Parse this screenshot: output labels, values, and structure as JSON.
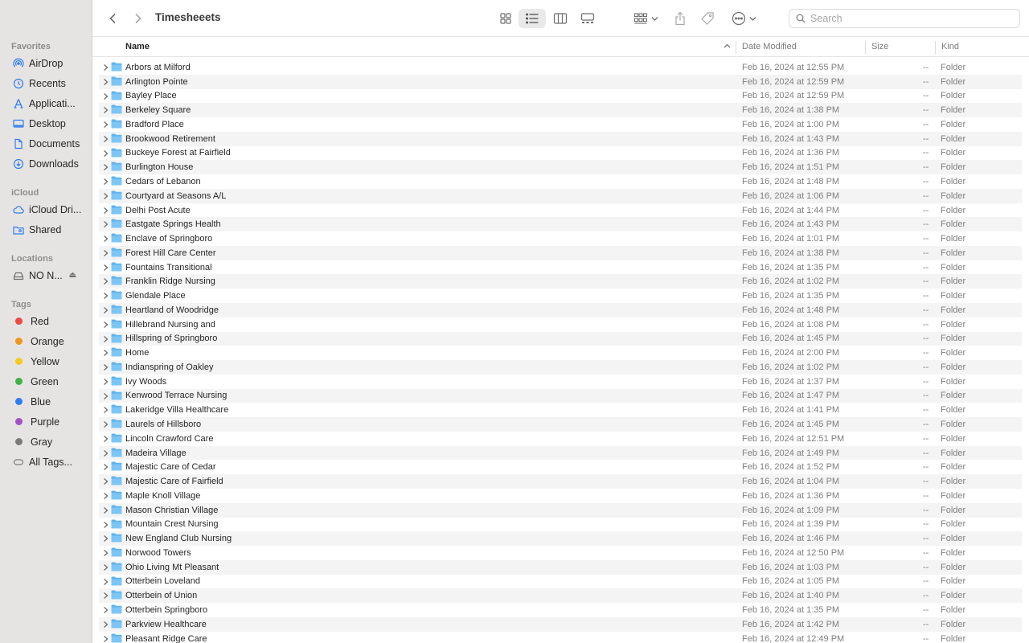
{
  "window": {
    "title": "Timesheeets"
  },
  "search": {
    "placeholder": "Search"
  },
  "sidebar": {
    "favorites_label": "Favorites",
    "favorites": [
      {
        "label": "AirDrop",
        "icon": "airdrop-icon"
      },
      {
        "label": "Recents",
        "icon": "clock-icon"
      },
      {
        "label": "Applicati...",
        "icon": "applications-icon"
      },
      {
        "label": "Desktop",
        "icon": "desktop-icon"
      },
      {
        "label": "Documents",
        "icon": "document-icon"
      },
      {
        "label": "Downloads",
        "icon": "download-icon"
      }
    ],
    "icloud_label": "iCloud",
    "icloud": [
      {
        "label": "iCloud Dri...",
        "icon": "cloud-icon"
      },
      {
        "label": "Shared",
        "icon": "shared-folder-icon"
      }
    ],
    "locations_label": "Locations",
    "locations": [
      {
        "label": "NO N...",
        "icon": "drive-icon"
      }
    ],
    "tags_label": "Tags",
    "tags": [
      {
        "label": "Red",
        "color": "#ec4a3f"
      },
      {
        "label": "Orange",
        "color": "#f0961f"
      },
      {
        "label": "Yellow",
        "color": "#f5c924"
      },
      {
        "label": "Green",
        "color": "#3fb344"
      },
      {
        "label": "Blue",
        "color": "#2f7cf2"
      },
      {
        "label": "Purple",
        "color": "#a450c6"
      },
      {
        "label": "Gray",
        "color": "#7b7b7b"
      }
    ],
    "all_tags": "All Tags..."
  },
  "columns": {
    "name": "Name",
    "date": "Date Modified",
    "size": "Size",
    "kind": "Kind"
  },
  "rows": [
    {
      "name": "Arbors at Milford",
      "date": "Feb 16, 2024 at 12:55 PM",
      "size": "--",
      "kind": "Folder"
    },
    {
      "name": "Arlington Pointe",
      "date": "Feb 16, 2024 at 12:59 PM",
      "size": "--",
      "kind": "Folder"
    },
    {
      "name": "Bayley Place",
      "date": "Feb 16, 2024 at 12:59 PM",
      "size": "--",
      "kind": "Folder"
    },
    {
      "name": "Berkeley Square",
      "date": "Feb 16, 2024 at 1:38 PM",
      "size": "--",
      "kind": "Folder"
    },
    {
      "name": "Bradford Place",
      "date": "Feb 16, 2024 at 1:00 PM",
      "size": "--",
      "kind": "Folder"
    },
    {
      "name": "Brookwood Retirement",
      "date": "Feb 16, 2024 at 1:43 PM",
      "size": "--",
      "kind": "Folder"
    },
    {
      "name": "Buckeye Forest at Fairfield",
      "date": "Feb 16, 2024 at 1:36 PM",
      "size": "--",
      "kind": "Folder"
    },
    {
      "name": "Burlington House",
      "date": "Feb 16, 2024 at 1:51 PM",
      "size": "--",
      "kind": "Folder"
    },
    {
      "name": "Cedars of Lebanon",
      "date": "Feb 16, 2024 at 1:48 PM",
      "size": "--",
      "kind": "Folder"
    },
    {
      "name": "Courtyard at Seasons A/L",
      "date": "Feb 16, 2024 at 1:06 PM",
      "size": "--",
      "kind": "Folder"
    },
    {
      "name": "Delhi Post Acute",
      "date": "Feb 16, 2024 at 1:44 PM",
      "size": "--",
      "kind": "Folder"
    },
    {
      "name": "Eastgate Springs Health",
      "date": "Feb 16, 2024 at 1:43 PM",
      "size": "--",
      "kind": "Folder"
    },
    {
      "name": "Enclave of Springboro",
      "date": "Feb 16, 2024 at 1:01 PM",
      "size": "--",
      "kind": "Folder"
    },
    {
      "name": "Forest Hill Care Center",
      "date": "Feb 16, 2024 at 1:38 PM",
      "size": "--",
      "kind": "Folder"
    },
    {
      "name": "Fountains Transitional",
      "date": "Feb 16, 2024 at 1:35 PM",
      "size": "--",
      "kind": "Folder"
    },
    {
      "name": "Franklin Ridge Nursing",
      "date": "Feb 16, 2024 at 1:02 PM",
      "size": "--",
      "kind": "Folder"
    },
    {
      "name": "Glendale Place",
      "date": "Feb 16, 2024 at 1:35 PM",
      "size": "--",
      "kind": "Folder"
    },
    {
      "name": "Heartland of Woodridge",
      "date": "Feb 16, 2024 at 1:48 PM",
      "size": "--",
      "kind": "Folder"
    },
    {
      "name": "Hillebrand Nursing and",
      "date": "Feb 16, 2024 at 1:08 PM",
      "size": "--",
      "kind": "Folder"
    },
    {
      "name": "Hillspring of Springboro",
      "date": "Feb 16, 2024 at 1:45 PM",
      "size": "--",
      "kind": "Folder"
    },
    {
      "name": "Home",
      "date": "Feb 16, 2024 at 2:00 PM",
      "size": "--",
      "kind": "Folder"
    },
    {
      "name": "Indianspring of Oakley",
      "date": "Feb 16, 2024 at 1:02 PM",
      "size": "--",
      "kind": "Folder"
    },
    {
      "name": "Ivy Woods",
      "date": "Feb 16, 2024 at 1:37 PM",
      "size": "--",
      "kind": "Folder"
    },
    {
      "name": "Kenwood Terrace Nursing",
      "date": "Feb 16, 2024 at 1:47 PM",
      "size": "--",
      "kind": "Folder"
    },
    {
      "name": "Lakeridge Villa Healthcare",
      "date": "Feb 16, 2024 at 1:41 PM",
      "size": "--",
      "kind": "Folder"
    },
    {
      "name": "Laurels of Hillsboro",
      "date": "Feb 16, 2024 at 1:45 PM",
      "size": "--",
      "kind": "Folder"
    },
    {
      "name": "Lincoln Crawford Care",
      "date": "Feb 16, 2024 at 12:51 PM",
      "size": "--",
      "kind": "Folder"
    },
    {
      "name": "Madeira Village",
      "date": "Feb 16, 2024 at 1:49 PM",
      "size": "--",
      "kind": "Folder"
    },
    {
      "name": "Majestic Care of Cedar",
      "date": "Feb 16, 2024 at 1:52 PM",
      "size": "--",
      "kind": "Folder"
    },
    {
      "name": "Majestic Care of Fairfield",
      "date": "Feb 16, 2024 at 1:04 PM",
      "size": "--",
      "kind": "Folder"
    },
    {
      "name": "Maple Knoll Village",
      "date": "Feb 16, 2024 at 1:36 PM",
      "size": "--",
      "kind": "Folder"
    },
    {
      "name": "Mason Christian Village",
      "date": "Feb 16, 2024 at 1:09 PM",
      "size": "--",
      "kind": "Folder"
    },
    {
      "name": "Mountain Crest Nursing",
      "date": "Feb 16, 2024 at 1:39 PM",
      "size": "--",
      "kind": "Folder"
    },
    {
      "name": "New England Club Nursing",
      "date": "Feb 16, 2024 at 1:46 PM",
      "size": "--",
      "kind": "Folder"
    },
    {
      "name": "Norwood Towers",
      "date": "Feb 16, 2024 at 12:50 PM",
      "size": "--",
      "kind": "Folder"
    },
    {
      "name": "Ohio Living Mt Pleasant",
      "date": "Feb 16, 2024 at 1:03 PM",
      "size": "--",
      "kind": "Folder"
    },
    {
      "name": "Otterbein Loveland",
      "date": "Feb 16, 2024 at 1:05 PM",
      "size": "--",
      "kind": "Folder"
    },
    {
      "name": "Otterbein of Union",
      "date": "Feb 16, 2024 at 1:40 PM",
      "size": "--",
      "kind": "Folder"
    },
    {
      "name": "Otterbein Springboro",
      "date": "Feb 16, 2024 at 1:35 PM",
      "size": "--",
      "kind": "Folder"
    },
    {
      "name": "Parkview Healthcare",
      "date": "Feb 16, 2024 at 1:42 PM",
      "size": "--",
      "kind": "Folder"
    },
    {
      "name": "Pleasant Ridge Care",
      "date": "Feb 16, 2024 at 12:49 PM",
      "size": "--",
      "kind": "Folder"
    }
  ]
}
